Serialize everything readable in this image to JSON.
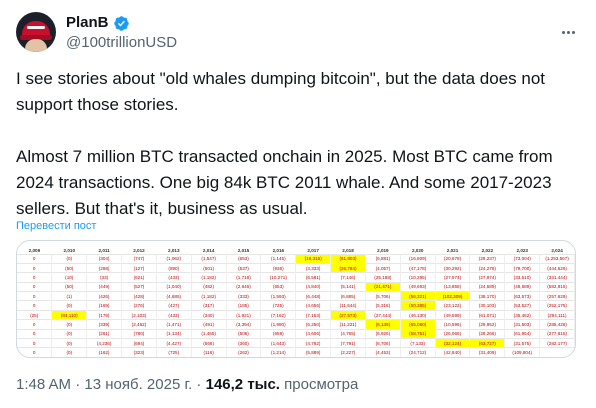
{
  "author": {
    "display_name": "PlanB",
    "handle": "@100trillionUSD",
    "verified_color": "#1d9bf0"
  },
  "tweet": {
    "paragraph1": "I see stories about \"old whales dumping bitcoin\", but the data does not support those stories.",
    "paragraph2": "Almost 7 million BTC transacted onchain in 2025. Most BTC came from 2024 transactions. One big 84k BTC 2011 whale. And some 2017-2023 sellers. But that's it, business as usual.",
    "translate_label": "Перевести пост"
  },
  "media": {
    "headers": [
      "2,009",
      "2,010",
      "2,011",
      "2,012",
      "2,013",
      "2,014",
      "2,015",
      "2,016",
      "2,017",
      "2,018",
      "2,019",
      "2,020",
      "2,021",
      "2,022",
      "2,023",
      "2,024"
    ],
    "rows": [
      [
        "0",
        "(0)",
        "(304)",
        "(747)",
        "(1,062)",
        "(1,547)",
        "(653)",
        "(1,145)",
        "(16,315)",
        "(61,803)",
        "(6,881)",
        "(16,809)",
        "(20,678)",
        "(28,237)",
        "(73,004)",
        "(1,253,667)"
      ],
      [
        "0",
        "(50)",
        "(288)",
        "(127)",
        "(890)",
        "(501)",
        "(537)",
        "(936)",
        "(3,333)",
        "(26,784)",
        "(4,057)",
        "(47,178)",
        "(30,292)",
        "(24,278)",
        "(79,700)",
        "(444,526)"
      ],
      [
        "0",
        "(10)",
        "(33)",
        "(621)",
        "(433)",
        "(1,182)",
        "(1,718)",
        "(10,271)",
        "(6,581)",
        "(7,146)",
        "(25,188)",
        "(10,295)",
        "(27,974)",
        "(27,974)",
        "(33,510)",
        "(331,444)"
      ],
      [
        "0",
        "(50)",
        "(449)",
        "(527)",
        "(1,040)",
        "(482)",
        "(2,646)",
        "(653)",
        "(4,840)",
        "(5,141)",
        "(21,471)",
        "(49,693)",
        "(13,858)",
        "(24,589)",
        "(49,689)",
        "(582,915)"
      ],
      [
        "0",
        "(1)",
        "(426)",
        "(428)",
        "(4,685)",
        "(1,182)",
        "(333)",
        "(1,593)",
        "(6,448)",
        "(6,885)",
        "(5,706)",
        "(56,321)",
        "(102,309)",
        "(38,170)",
        "(63,573)",
        "(257,629)"
      ],
      [
        "0",
        "(0)",
        "(169)",
        "(276)",
        "(427)",
        "(317)",
        "(185)",
        "(725)",
        "(4,656)",
        "(11,644)",
        "(5,316)",
        "(50,385)",
        "(23,122)",
        "(30,103)",
        "(53,527)",
        "(252,175)"
      ],
      [
        "(25)",
        "(84,110)",
        "(179)",
        "(2,103)",
        "(433)",
        "(340)",
        "(1,921)",
        "(7,162)",
        "(7,153)",
        "(27,573)",
        "(27,444)",
        "(46,130)",
        "(49,599)",
        "(61,071)",
        "(35,462)",
        "(294,111)"
      ],
      [
        "0",
        "(0)",
        "(339)",
        "(2,462)",
        "(1,471)",
        "(491)",
        "(3,394)",
        "(1,980)",
        "(6,250)",
        "(11,221)",
        "(6,139)",
        "(65,080)",
        "(10,596)",
        "(29,952)",
        "(31,503)",
        "(285,428)"
      ],
      [
        "0",
        "(0)",
        "(261)",
        "(780)",
        "(1,134)",
        "(1,465)",
        "(506)",
        "(659)",
        "(4,606)",
        "(4,765)",
        "(6,926)",
        "(58,751)",
        "(26,066)",
        "(28,266)",
        "(61,954)",
        "(277,615)"
      ],
      [
        "0",
        "(0)",
        "(4,236)",
        "(694)",
        "(4,427)",
        "(566)",
        "(360)",
        "(1,643)",
        "(4,762)",
        "(7,791)",
        "(6,706)",
        "(7,133)",
        "(32,124)",
        "(63,727)",
        "(31,575)",
        "(282,177)"
      ],
      [
        "0",
        "(0)",
        "(162)",
        "(323)",
        "(725)",
        "(116)",
        "(262)",
        "(1,214)",
        "(5,889)",
        "(2,227)",
        "(4,453)",
        "(24,712)",
        "(42,840)",
        "(31,409)",
        "(109,804)",
        ""
      ]
    ],
    "highlights": [
      [
        0,
        8
      ],
      [
        0,
        9
      ],
      [
        1,
        9
      ],
      [
        3,
        10
      ],
      [
        4,
        11
      ],
      [
        4,
        12
      ],
      [
        5,
        11
      ],
      [
        6,
        1
      ],
      [
        6,
        9
      ],
      [
        7,
        10
      ],
      [
        7,
        11
      ],
      [
        8,
        11
      ],
      [
        9,
        12
      ],
      [
        9,
        13
      ]
    ],
    "highlight_color": "#ffff00",
    "value_color": "#c00000"
  },
  "meta": {
    "time": "1:48 AM",
    "separator": " · ",
    "date": "13 нояб. 2025 г.",
    "views_count": "146,2 тыс.",
    "views_label": " просмотра"
  }
}
